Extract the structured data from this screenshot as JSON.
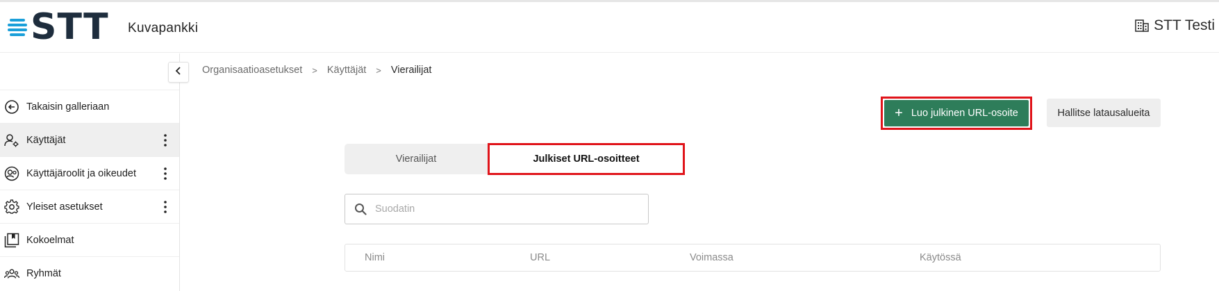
{
  "header": {
    "logo_text": "STT",
    "app_name": "Kuvapankki",
    "organization": "STT Testi",
    "organization_icon": "building-icon"
  },
  "sidebar": {
    "collapse_icon": "chevron-left-icon",
    "items": [
      {
        "label": "Takaisin galleriaan",
        "icon": "arrow-left-circle-icon",
        "active": false,
        "has_menu": false
      },
      {
        "label": "Käyttäjät",
        "icon": "user-settings-icon",
        "active": true,
        "has_menu": true
      },
      {
        "label": "Käyttäjäroolit ja oikeudet",
        "icon": "user-role-icon",
        "active": false,
        "has_menu": true
      },
      {
        "label": "Yleiset asetukset",
        "icon": "gear-icon",
        "active": false,
        "has_menu": true
      },
      {
        "label": "Kokoelmat",
        "icon": "collection-icon",
        "active": false,
        "has_menu": false
      },
      {
        "label": "Ryhmät",
        "icon": "group-icon",
        "active": false,
        "has_menu": false
      }
    ]
  },
  "breadcrumb": {
    "items": [
      "Organisaatioasetukset",
      "Käyttäjät",
      "Vierailijat"
    ],
    "separator": ">"
  },
  "actions": {
    "create_public_url": "Luo julkinen URL-osoite",
    "manage_upload_areas": "Hallitse latausalueita"
  },
  "tabs": [
    {
      "label": "Vierailijat",
      "selected": false
    },
    {
      "label": "Julkiset URL-osoitteet",
      "selected": true
    }
  ],
  "search": {
    "placeholder": "Suodatin",
    "value": ""
  },
  "table": {
    "columns": [
      "Nimi",
      "URL",
      "Voimassa",
      "Käytössä"
    ],
    "rows": []
  },
  "colors": {
    "primary_green": "#2e7d5a",
    "highlight_red": "#e0141a",
    "logo_blue": "#1b9fd9",
    "logo_dark": "#1e2d3d"
  }
}
